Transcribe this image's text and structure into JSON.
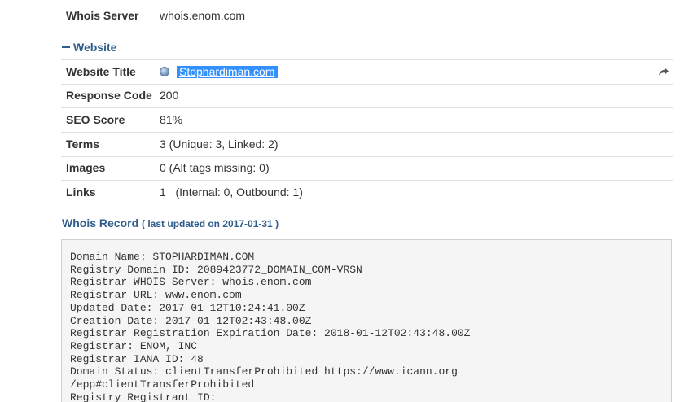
{
  "whois_server": {
    "label": "Whois Server",
    "value": "whois.enom.com"
  },
  "website_section": {
    "title": "Website",
    "rows": [
      {
        "label": "Website Title",
        "value": "Stophardiman.com"
      },
      {
        "label": "Response Code",
        "value": "200"
      },
      {
        "label": "SEO Score",
        "value": "81%"
      },
      {
        "label": "Terms",
        "value": "3 (Unique: 3, Linked: 2)"
      },
      {
        "label": "Images",
        "value": "0 (Alt tags missing: 0)"
      },
      {
        "label": "Links",
        "value": "1   (Internal: 0, Outbound: 1)"
      }
    ]
  },
  "whois_record": {
    "title": "Whois Record",
    "updated_note": "( last updated on 2017-01-31 )",
    "lines": [
      "Domain Name: STOPHARDIMAN.COM",
      "Registry Domain ID: 2089423772_DOMAIN_COM-VRSN",
      "Registrar WHOIS Server: whois.enom.com",
      "Registrar URL: www.enom.com",
      "Updated Date: 2017-01-12T10:24:41.00Z",
      "Creation Date: 2017-01-12T02:43:48.00Z",
      "Registrar Registration Expiration Date: 2018-01-12T02:43:48.00Z",
      "Registrar: ENOM, INC",
      "Registrar IANA ID: 48",
      "Domain Status: clientTransferProhibited https://www.icann.org",
      "/epp#clientTransferProhibited",
      "Registry Registrant ID:"
    ]
  },
  "icons": {
    "globe": "globe-icon",
    "share": "share-arrow-icon",
    "collapse": "minus-icon"
  },
  "colors": {
    "accent": "#2f5d8c",
    "selection": "#3390ff",
    "border": "#e1e1e1"
  }
}
